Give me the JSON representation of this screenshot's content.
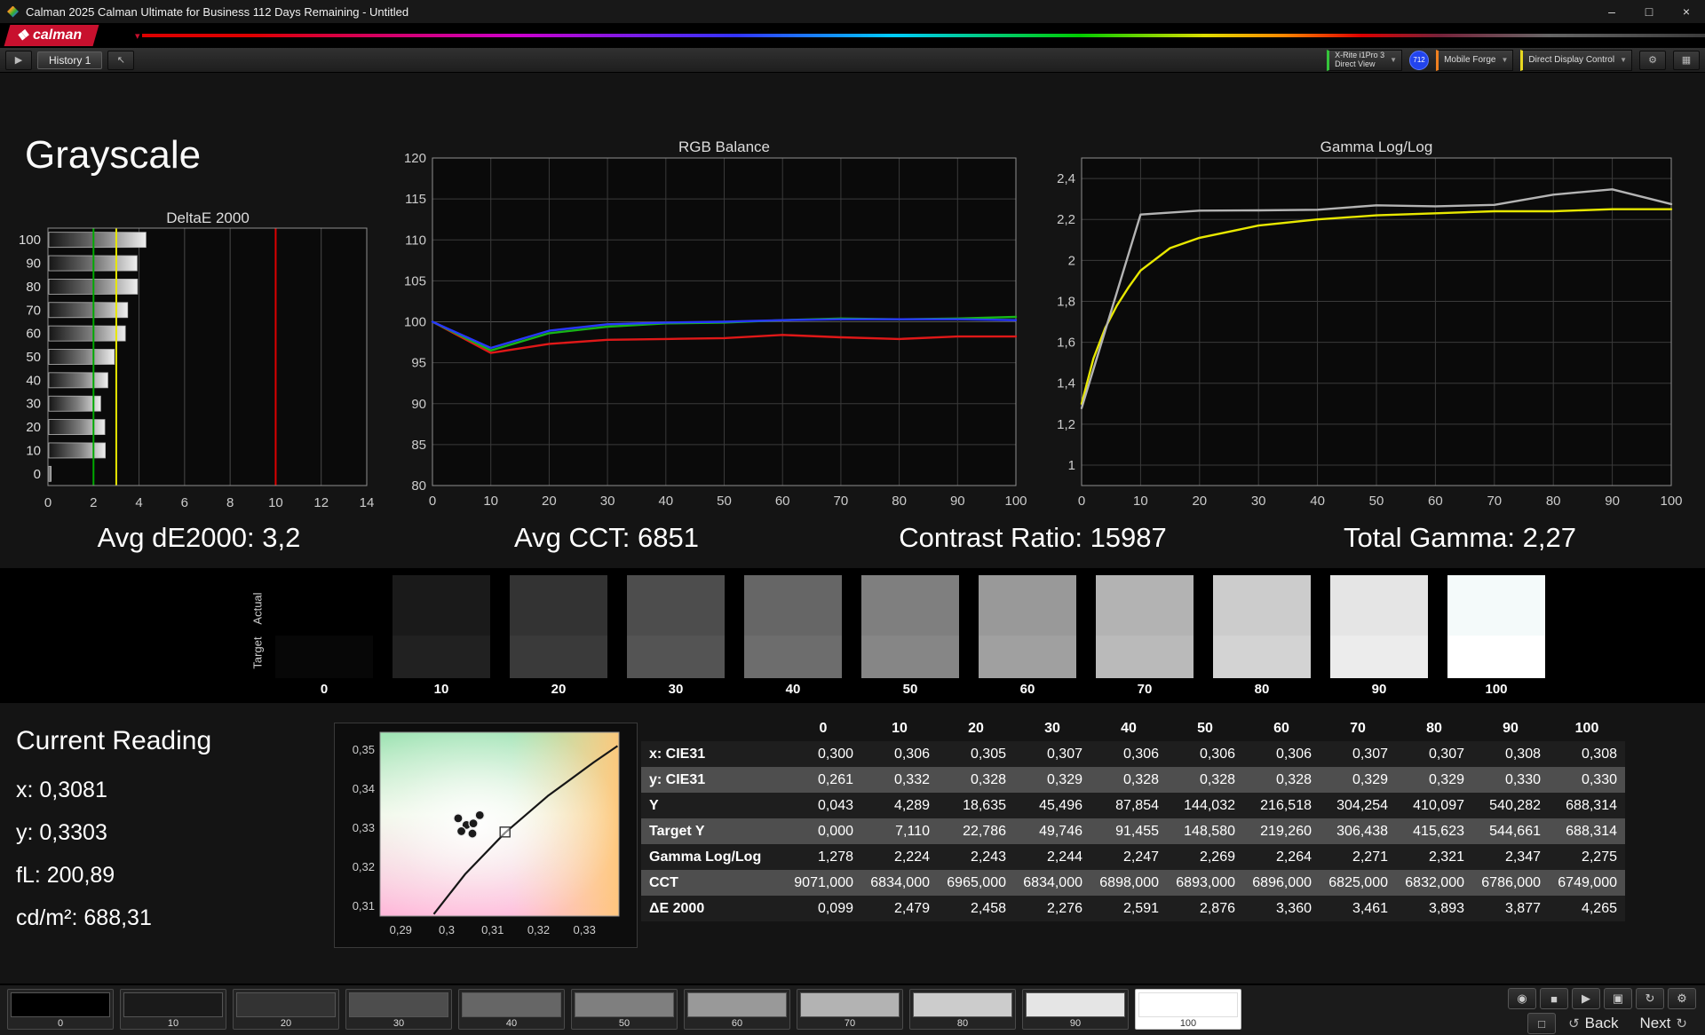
{
  "window": {
    "title": "Calman 2025 Calman Ultimate for Business 112 Days Remaining  - Untitled",
    "minimize": "–",
    "maximize": "□",
    "close": "×"
  },
  "brand": {
    "logo_text": "calman",
    "accent": "#c8102e"
  },
  "toolbar": {
    "history_tab": "History 1",
    "meter_line1": "X-Rite i1Pro 3",
    "meter_line2": "Direct View",
    "meter_accent": "#35c43b",
    "badge": "712",
    "source": "Mobile Forge",
    "source_accent": "#f08020",
    "display_control": "Direct Display Control",
    "display_accent": "#e8d820"
  },
  "page": {
    "title": "Grayscale"
  },
  "stats": [
    {
      "text": "Avg dE2000: 3,2"
    },
    {
      "text": "Avg CCT: 6851"
    },
    {
      "text": "Contrast Ratio: 15987"
    },
    {
      "text": "Total Gamma: 2,27"
    }
  ],
  "swatch_strip": {
    "actual_label": "Actual",
    "target_label": "Target",
    "items": [
      {
        "label": "0",
        "value": 0
      },
      {
        "label": "10",
        "value": 10
      },
      {
        "label": "20",
        "value": 20
      },
      {
        "label": "30",
        "value": 30
      },
      {
        "label": "40",
        "value": 40
      },
      {
        "label": "50",
        "value": 50
      },
      {
        "label": "60",
        "value": 60
      },
      {
        "label": "70",
        "value": 70
      },
      {
        "label": "80",
        "value": 80
      },
      {
        "label": "90",
        "value": 90
      },
      {
        "label": "100",
        "value": 100
      }
    ]
  },
  "current_reading": {
    "title": "Current Reading",
    "lines": [
      "x: 0,3081",
      "y: 0,3303",
      "fL: 200,89",
      "cd/m²: 688,31"
    ]
  },
  "table": {
    "columns": [
      "",
      "0",
      "10",
      "20",
      "30",
      "40",
      "50",
      "60",
      "70",
      "80",
      "90",
      "100"
    ],
    "rows": [
      {
        "label": "x: CIE31",
        "values": [
          "0,300",
          "0,306",
          "0,305",
          "0,307",
          "0,306",
          "0,306",
          "0,306",
          "0,307",
          "0,307",
          "0,308",
          "0,308"
        ]
      },
      {
        "label": "y: CIE31",
        "values": [
          "0,261",
          "0,332",
          "0,328",
          "0,329",
          "0,328",
          "0,328",
          "0,328",
          "0,329",
          "0,329",
          "0,330",
          "0,330"
        ]
      },
      {
        "label": "Y",
        "values": [
          "0,043",
          "4,289",
          "18,635",
          "45,496",
          "87,854",
          "144,032",
          "216,518",
          "304,254",
          "410,097",
          "540,282",
          "688,314"
        ]
      },
      {
        "label": "Target Y",
        "values": [
          "0,000",
          "7,110",
          "22,786",
          "49,746",
          "91,455",
          "148,580",
          "219,260",
          "306,438",
          "415,623",
          "544,661",
          "688,314"
        ]
      },
      {
        "label": "Gamma Log/Log",
        "values": [
          "1,278",
          "2,224",
          "2,243",
          "2,244",
          "2,247",
          "2,269",
          "2,264",
          "2,271",
          "2,321",
          "2,347",
          "2,275"
        ]
      },
      {
        "label": "CCT",
        "values": [
          "9071,000",
          "6834,000",
          "6965,000",
          "6834,000",
          "6898,000",
          "6893,000",
          "6896,000",
          "6825,000",
          "6832,000",
          "6786,000",
          "6749,000"
        ]
      },
      {
        "label": "ΔE 2000",
        "values": [
          "0,099",
          "2,479",
          "2,458",
          "2,276",
          "2,591",
          "2,876",
          "3,360",
          "3,461",
          "3,893",
          "3,877",
          "4,265"
        ]
      }
    ]
  },
  "bottom_bar": {
    "patches": [
      {
        "label": "0",
        "value": 0
      },
      {
        "label": "10",
        "value": 10
      },
      {
        "label": "20",
        "value": 20
      },
      {
        "label": "30",
        "value": 30
      },
      {
        "label": "40",
        "value": 40
      },
      {
        "label": "50",
        "value": 50
      },
      {
        "label": "60",
        "value": 60
      },
      {
        "label": "70",
        "value": 70
      },
      {
        "label": "80",
        "value": 80
      },
      {
        "label": "90",
        "value": 90
      },
      {
        "label": "100",
        "value": 100,
        "active": true
      }
    ],
    "icons_row1": [
      {
        "name": "snapshot-icon",
        "glyph": "◉"
      },
      {
        "name": "stop-icon",
        "glyph": "■"
      },
      {
        "name": "play-icon",
        "glyph": "▶"
      },
      {
        "name": "save-icon",
        "glyph": "▣"
      },
      {
        "name": "refresh-icon",
        "glyph": "↻"
      },
      {
        "name": "settings-icon",
        "glyph": "⚙"
      }
    ],
    "window_button_glyph": "□",
    "back": "Back",
    "next": "Next",
    "back_icon": "↺",
    "next_icon": "↻"
  },
  "chart_data": [
    {
      "type": "bar",
      "orientation": "horizontal",
      "title": "DeltaE 2000",
      "categories": [
        "100",
        "90",
        "80",
        "70",
        "60",
        "50",
        "40",
        "30",
        "20",
        "10",
        "0"
      ],
      "values": [
        4.265,
        3.877,
        3.893,
        3.461,
        3.36,
        2.876,
        2.591,
        2.276,
        2.458,
        2.479,
        0.099
      ],
      "xlim": [
        0,
        14
      ],
      "xticks": [
        0,
        2,
        4,
        6,
        8,
        10,
        12,
        14
      ],
      "ref_lines": [
        {
          "x": 2,
          "color": "#00aa00"
        },
        {
          "x": 3,
          "color": "#e8e800"
        },
        {
          "x": 10,
          "color": "#dd0000"
        }
      ]
    },
    {
      "type": "line",
      "title": "RGB Balance",
      "x": [
        0,
        10,
        20,
        30,
        40,
        50,
        60,
        70,
        80,
        90,
        100
      ],
      "xlim": [
        0,
        100
      ],
      "xticks": [
        0,
        10,
        20,
        30,
        40,
        50,
        60,
        70,
        80,
        90,
        100
      ],
      "ylim": [
        80,
        120
      ],
      "yticks": [
        80,
        85,
        90,
        95,
        100,
        105,
        110,
        115,
        120
      ],
      "series": [
        {
          "name": "Red",
          "color": "#e01818",
          "values": [
            100,
            96.2,
            97.3,
            97.8,
            97.9,
            98.0,
            98.4,
            98.1,
            97.9,
            98.2,
            98.2
          ]
        },
        {
          "name": "Green",
          "color": "#18b418",
          "values": [
            100,
            96.5,
            98.6,
            99.4,
            99.8,
            99.9,
            100.2,
            100.4,
            100.3,
            100.4,
            100.6
          ]
        },
        {
          "name": "Blue",
          "color": "#2838ff",
          "values": [
            100,
            96.8,
            98.9,
            99.7,
            99.9,
            100.0,
            100.2,
            100.3,
            100.3,
            100.3,
            100.2
          ]
        }
      ]
    },
    {
      "type": "line",
      "title": "Gamma Log/Log",
      "xlim": [
        0,
        100
      ],
      "xticks": [
        0,
        10,
        20,
        30,
        40,
        50,
        60,
        70,
        80,
        90,
        100
      ],
      "ylim": [
        0.9,
        2.5
      ],
      "yticks": [
        1,
        1.2,
        1.4,
        1.6,
        1.8,
        2,
        2.2,
        2.4
      ],
      "ytick_labels": [
        "1",
        "1,2",
        "1,4",
        "1,6",
        "1,8",
        "2",
        "2,2",
        "2,4"
      ],
      "series": [
        {
          "name": "Gamma Target",
          "color": "#e8e800",
          "x": [
            0,
            2,
            4,
            6,
            8,
            10,
            15,
            20,
            30,
            40,
            50,
            60,
            70,
            80,
            90,
            100
          ],
          "values": [
            1.3,
            1.52,
            1.67,
            1.78,
            1.87,
            1.95,
            2.06,
            2.11,
            2.17,
            2.2,
            2.22,
            2.23,
            2.24,
            2.24,
            2.25,
            2.25
          ]
        },
        {
          "name": "Gamma Measured",
          "color": "#b4b4b4",
          "x": [
            0,
            10,
            20,
            30,
            40,
            50,
            60,
            70,
            80,
            90,
            100
          ],
          "values": [
            1.278,
            2.224,
            2.243,
            2.244,
            2.247,
            2.269,
            2.264,
            2.271,
            2.321,
            2.347,
            2.275
          ]
        }
      ]
    },
    {
      "type": "scatter",
      "xlim": [
        0.2855,
        0.3375
      ],
      "xticks": [
        0.29,
        0.3,
        0.31,
        0.32,
        0.33
      ],
      "xtick_labels": [
        "0,29",
        "0,3",
        "0,31",
        "0,32",
        "0,33"
      ],
      "ylim": [
        0.3075,
        0.3545
      ],
      "yticks": [
        0.31,
        0.32,
        0.33,
        0.34,
        0.35
      ],
      "ytick_labels": [
        "0,31",
        "0,32",
        "0,33",
        "0,34",
        "0,35"
      ],
      "points": [
        [
          0.3025,
          0.3325
        ],
        [
          0.3043,
          0.3308
        ],
        [
          0.3058,
          0.3312
        ],
        [
          0.3072,
          0.3333
        ],
        [
          0.3032,
          0.3292
        ],
        [
          0.3056,
          0.3286
        ]
      ],
      "target": [
        0.3127,
        0.329
      ],
      "locus": [
        [
          0.2972,
          0.308
        ],
        [
          0.304,
          0.3182
        ],
        [
          0.3127,
          0.3288
        ],
        [
          0.322,
          0.3382
        ],
        [
          0.332,
          0.3468
        ],
        [
          0.3372,
          0.351
        ]
      ]
    }
  ]
}
